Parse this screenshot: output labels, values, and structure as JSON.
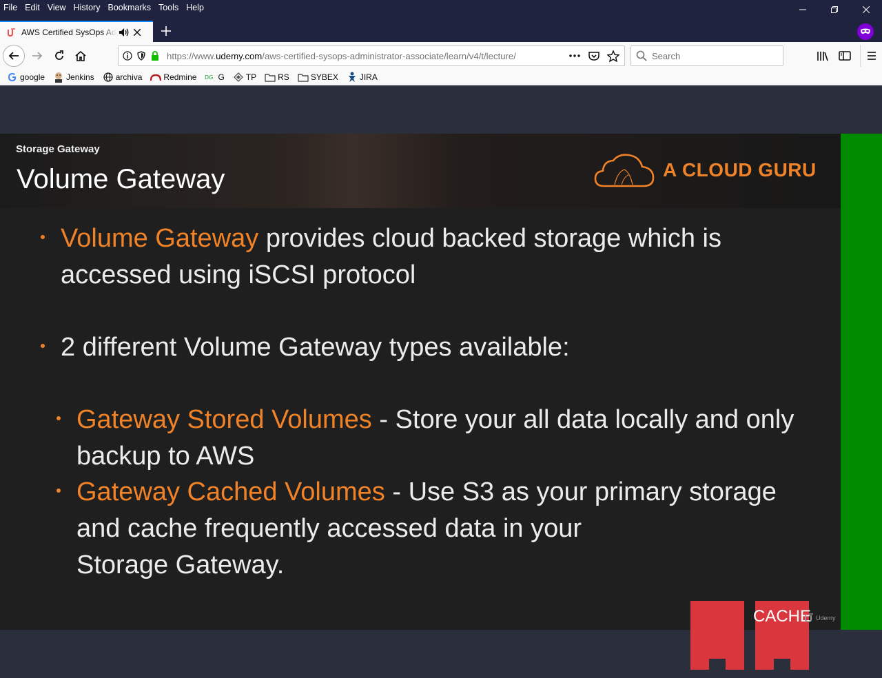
{
  "menu": [
    "File",
    "Edit",
    "View",
    "History",
    "Bookmarks",
    "Tools",
    "Help"
  ],
  "tab": {
    "title": "AWS Certified SysOps Administrator - Associate | Udemy"
  },
  "url": {
    "prefix": "https://www.",
    "domain": "udemy.com",
    "path": "/aws-certified-sysops-administrator-associate/learn/v4/t/lecture/"
  },
  "search": {
    "placeholder": "Search"
  },
  "bookmarks": [
    "google",
    "Jenkins",
    "archiva",
    "Redmine",
    "G",
    "TP",
    "RS",
    "SYBEX",
    "JIRA"
  ],
  "slide": {
    "section": "Storage Gateway",
    "title": "Volume Gateway",
    "logo_text": "A CLOUD GURU",
    "bullets": {
      "b1_highlight": "Volume Gateway",
      "b1_text": " provides cloud backed storage which is accessed using iSCSI protocol",
      "b2_text": "2 different Volume Gateway types available:",
      "b3_highlight": "Gateway Stored  Volumes",
      "b3_text": " - Store your all data locally and only backup to AWS",
      "b4_highlight": "Gateway Cached  Volumes",
      "b4_text": " - Use S3 as your primary storage and cache frequently accessed data in your",
      "b4_line3": "Storage Gateway."
    },
    "cache_label": "CACHE",
    "watermark": "Udemy"
  },
  "colors": {
    "accent_orange": "#f08228",
    "udemy_red": "#ec5252",
    "cache_red": "#d9363e",
    "green": "#008a00"
  }
}
